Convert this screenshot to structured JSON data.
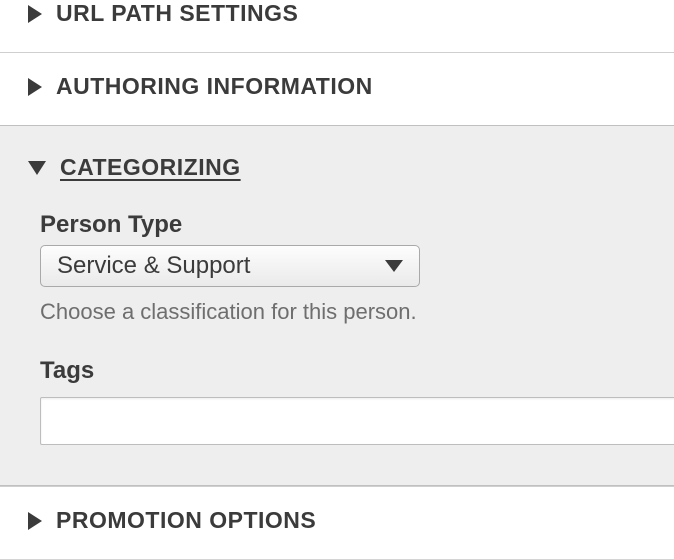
{
  "sections": {
    "url_path": {
      "title": "URL PATH SETTINGS"
    },
    "authoring": {
      "title": "AUTHORING INFORMATION"
    },
    "categorizing": {
      "title": "CATEGORIZING",
      "person_type": {
        "label": "Person Type",
        "selected": "Service & Support",
        "help": "Choose a classification for this person."
      },
      "tags": {
        "label": "Tags",
        "value": ""
      }
    },
    "promotion": {
      "title": "PROMOTION OPTIONS"
    }
  }
}
